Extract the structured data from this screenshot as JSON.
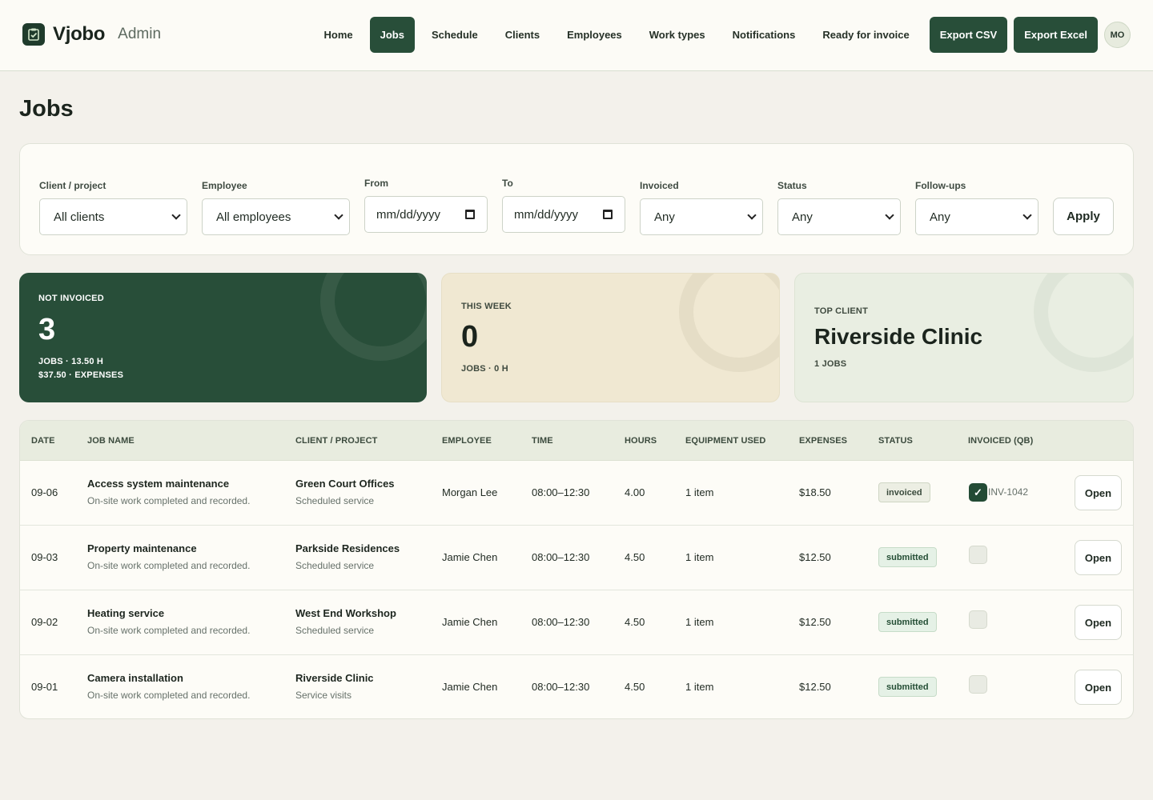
{
  "brand": {
    "name": "Vjobo",
    "sub": "Admin"
  },
  "nav": {
    "items": [
      "Home",
      "Jobs",
      "Schedule",
      "Clients",
      "Employees",
      "Work types",
      "Notifications",
      "Ready for invoice"
    ],
    "active": "Jobs",
    "export_csv": "Export CSV",
    "export_excel": "Export Excel",
    "avatar": "MO"
  },
  "page": {
    "title": "Jobs"
  },
  "filters": {
    "client": {
      "label": "Client / project",
      "value": "All clients"
    },
    "employee": {
      "label": "Employee",
      "value": "All employees"
    },
    "from": {
      "label": "From",
      "value": "mm/dd/yyyy"
    },
    "to": {
      "label": "To",
      "value": "mm/dd/yyyy"
    },
    "invoiced": {
      "label": "Invoiced",
      "value": "Any"
    },
    "status": {
      "label": "Status",
      "value": "Any"
    },
    "followups": {
      "label": "Follow-ups",
      "value": "Any"
    },
    "apply": "Apply"
  },
  "stats": {
    "not_invoiced": {
      "caption": "NOT INVOICED",
      "value": "3",
      "line1": "JOBS · 13.50 H",
      "line2": "$37.50 · EXPENSES"
    },
    "this_week": {
      "caption": "THIS WEEK",
      "value": "0",
      "line1": "JOBS · 0 H"
    },
    "top_client": {
      "caption": "TOP CLIENT",
      "value": "Riverside Clinic",
      "line1": "1 JOBS"
    }
  },
  "table": {
    "headers": [
      "DATE",
      "JOB NAME",
      "CLIENT / PROJECT",
      "EMPLOYEE",
      "TIME",
      "HOURS",
      "EQUIPMENT USED",
      "EXPENSES",
      "STATUS",
      "INVOICED (QB)"
    ],
    "open_label": "Open",
    "rows": [
      {
        "date": "09-06",
        "job": "Access system maintenance",
        "job_sub": "On-site work completed and recorded.",
        "client": "Green Court Offices",
        "client_sub": "Scheduled service",
        "employee": "Morgan Lee",
        "time": "08:00–12:30",
        "hours": "4.00",
        "equipment": "1 item",
        "expenses": "$18.50",
        "status": "invoiced",
        "invoiced": true,
        "invoice_no": "INV-1042"
      },
      {
        "date": "09-03",
        "job": "Property maintenance",
        "job_sub": "On-site work completed and recorded.",
        "client": "Parkside Residences",
        "client_sub": "Scheduled service",
        "employee": "Jamie Chen",
        "time": "08:00–12:30",
        "hours": "4.50",
        "equipment": "1 item",
        "expenses": "$12.50",
        "status": "submitted",
        "invoiced": false,
        "invoice_no": ""
      },
      {
        "date": "09-02",
        "job": "Heating service",
        "job_sub": "On-site work completed and recorded.",
        "client": "West End Workshop",
        "client_sub": "Scheduled service",
        "employee": "Jamie Chen",
        "time": "08:00–12:30",
        "hours": "4.50",
        "equipment": "1 item",
        "expenses": "$12.50",
        "status": "submitted",
        "invoiced": false,
        "invoice_no": ""
      },
      {
        "date": "09-01",
        "job": "Camera installation",
        "job_sub": "On-site work completed and recorded.",
        "client": "Riverside Clinic",
        "client_sub": "Service visits",
        "employee": "Jamie Chen",
        "time": "08:00–12:30",
        "hours": "4.50",
        "equipment": "1 item",
        "expenses": "$12.50",
        "status": "submitted",
        "invoiced": false,
        "invoice_no": ""
      }
    ]
  },
  "colors": {
    "brand_green": "#284e39",
    "page_bg": "#f3f1eb",
    "card_cream": "#f0e8d2",
    "card_sage": "#e9eee2"
  },
  "icons": {
    "logo": "clipboard-check-icon",
    "select": "chevron-down-icon",
    "date": "calendar-icon",
    "check": "checkmark-icon"
  }
}
